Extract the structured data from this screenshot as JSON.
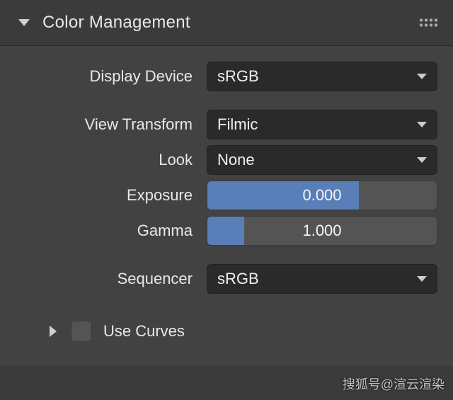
{
  "panel": {
    "title": "Color Management"
  },
  "fields": {
    "display_device": {
      "label": "Display Device",
      "value": "sRGB"
    },
    "view_transform": {
      "label": "View Transform",
      "value": "Filmic"
    },
    "look": {
      "label": "Look",
      "value": "None"
    },
    "exposure": {
      "label": "Exposure",
      "value": "0.000",
      "fill_percent": 66
    },
    "gamma": {
      "label": "Gamma",
      "value": "1.000",
      "fill_percent": 16
    },
    "sequencer": {
      "label": "Sequencer",
      "value": "sRGB"
    }
  },
  "use_curves": {
    "label": "Use Curves",
    "checked": false
  },
  "watermark": "搜狐号@渲云渲染"
}
